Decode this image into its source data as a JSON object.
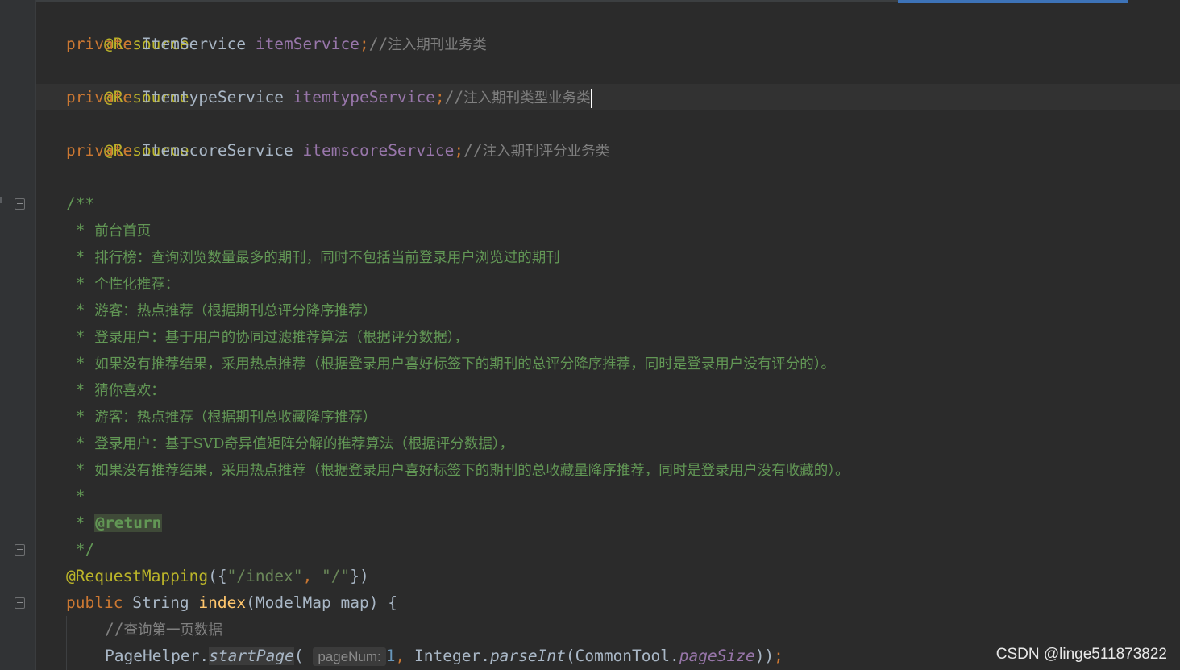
{
  "code": {
    "line1": {
      "annotation": "@Resource"
    },
    "line2": {
      "kw": "private",
      "type": "ItemService",
      "field": "itemService",
      "semi": ";",
      "comment_slash": "//",
      "comment_text": "注入期刊业务类"
    },
    "line3": {
      "annotation": "@Resource"
    },
    "line4": {
      "kw": "private",
      "type": "ItemtypeService",
      "field": "itemtypeService",
      "semi": ";",
      "comment_slash": "//",
      "comment_text": "注入期刊类型业务类"
    },
    "line5": {
      "annotation": "@Resource"
    },
    "line6": {
      "kw": "private",
      "type": "ItemscoreService",
      "field": "itemscoreService",
      "semi": ";",
      "comment_slash": "//",
      "comment_text": "注入期刊评分业务类"
    },
    "doc": {
      "open": "/**",
      "star": " * ",
      "lines": [
        "前台首页",
        "排行榜：查询浏览数量最多的期刊，同时不包括当前登录用户浏览过的期刊",
        "个性化推荐：",
        "游客：热点推荐（根据期刊总评分降序推荐）",
        "登录用户：基于用户的协同过滤推荐算法（根据评分数据），",
        "如果没有推荐结果，采用热点推荐（根据登录用户喜好标签下的期刊的总评分降序推荐，同时是登录用户没有评分的）。",
        "猜你喜欢：",
        "游客：热点推荐（根据期刊总收藏降序推荐）",
        "登录用户：基于SVD奇异值矩阵分解的推荐算法（根据评分数据），",
        "如果没有推荐结果，采用热点推荐（根据登录用户喜好标签下的期刊的总收藏量降序推荐，同时是登录用户没有收藏的）。"
      ],
      "empty_star": " *",
      "return_tag": "@return",
      "close": " */"
    },
    "mapping": {
      "annotation": "@RequestMapping",
      "open": "({",
      "path1": "\"/index\"",
      "comma": ", ",
      "path2": "\"/\"",
      "close": "})"
    },
    "method_sig": {
      "kw1": "public",
      "type": "String",
      "name": "index",
      "params": "(ModelMap map) {"
    },
    "comment_line": {
      "slash": "//",
      "text": "查询第一页数据"
    },
    "last_line": {
      "class": "PageHelper",
      "dot": ".",
      "method": "startPage",
      "paren": "(",
      "hint": "pageNum:",
      "number": "1",
      "comma": ", ",
      "integer": "Integer",
      "parse": "parseInt",
      "arg_open": "(",
      "common": "CommonTool",
      "page_size": "pageSize",
      "close": "))",
      "semi": ";"
    }
  },
  "watermark": "CSDN @linge511873822"
}
